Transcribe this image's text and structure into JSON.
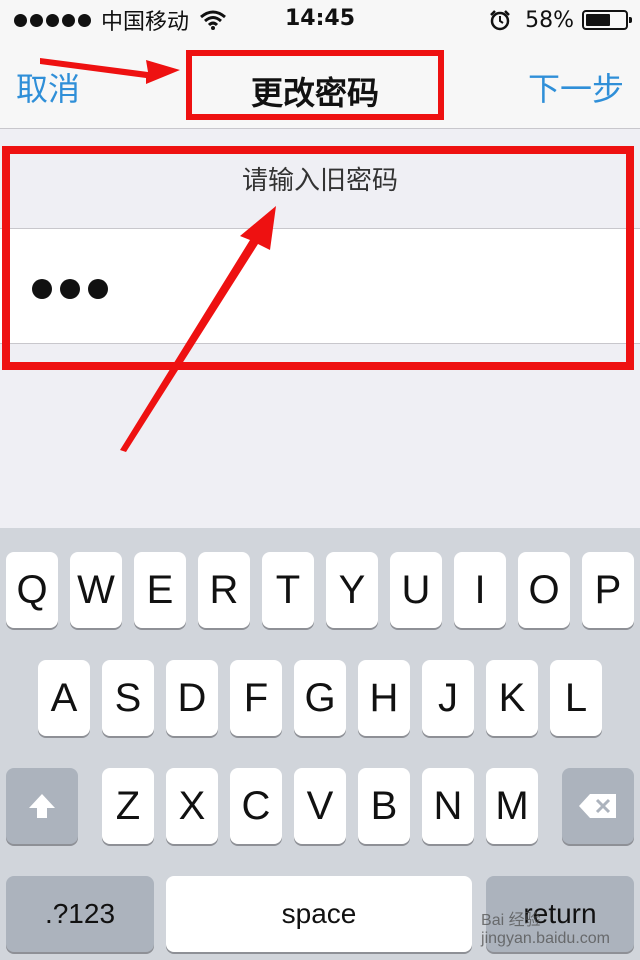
{
  "status_bar": {
    "carrier": "中国移动",
    "time": "14:45",
    "battery_percent": "58%",
    "battery_level": 0.58,
    "signal_bars": 5,
    "icons": [
      "signal-dots-icon",
      "wifi-icon",
      "alarm-icon",
      "battery-icon"
    ]
  },
  "nav": {
    "cancel_label": "取消",
    "title": "更改密码",
    "next_label": "下一步"
  },
  "form": {
    "prompt": "请输入旧密码",
    "password_length": 3
  },
  "keyboard": {
    "row1": [
      "Q",
      "W",
      "E",
      "R",
      "T",
      "Y",
      "U",
      "I",
      "O",
      "P"
    ],
    "row2": [
      "A",
      "S",
      "D",
      "F",
      "G",
      "H",
      "J",
      "K",
      "L"
    ],
    "row3": [
      "Z",
      "X",
      "C",
      "V",
      "B",
      "N",
      "M"
    ],
    "shift_icon": "shift-icon",
    "delete_icon": "delete-icon",
    "numbers_label": ".?123",
    "space_label": "space",
    "return_label": "return"
  },
  "watermark": {
    "text": "Bai 经验",
    "url": "jingyan.baidu.com"
  },
  "colors": {
    "accent": "#2f8fd8",
    "annotation_red": "#ee1111"
  }
}
